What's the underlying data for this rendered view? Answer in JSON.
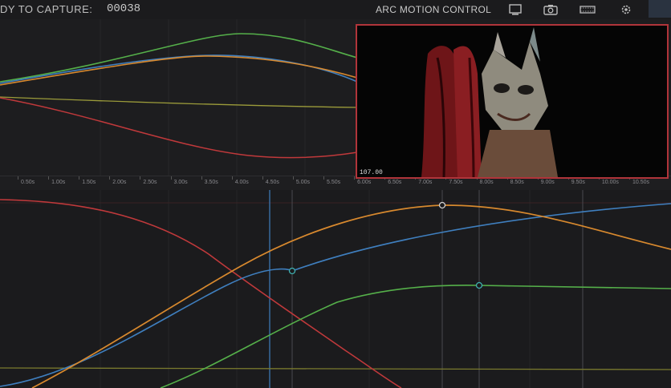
{
  "header": {
    "ready_label": "DY TO CAPTURE:",
    "frame_count": "00038",
    "title": "ARC MOTION CONTROL"
  },
  "toolbar": {
    "icons": [
      "monitor-icon",
      "camera-icon",
      "film-strip-icon",
      "settings-icon"
    ]
  },
  "preview": {
    "timecode": "107.00"
  },
  "timeline": {
    "ticks": [
      "0.50s",
      "1.00s",
      "1.50s",
      "2.00s",
      "2.50s",
      "3.00s",
      "3.50s",
      "4.00s",
      "4.50s",
      "5.00s",
      "5.50s",
      "6.00s",
      "6.50s",
      "7.00s",
      "7.50s",
      "8.00s",
      "8.50s",
      "9.00s",
      "9.50s",
      "10.00s",
      "10.50s"
    ]
  },
  "colors": {
    "orange": "#d8892e",
    "blue": "#3f7fbf",
    "green": "#55b04a",
    "red": "#c0393b",
    "olive": "#8a8a3a",
    "accent_border": "#b0343a",
    "playhead": "#3f7fbf"
  }
}
